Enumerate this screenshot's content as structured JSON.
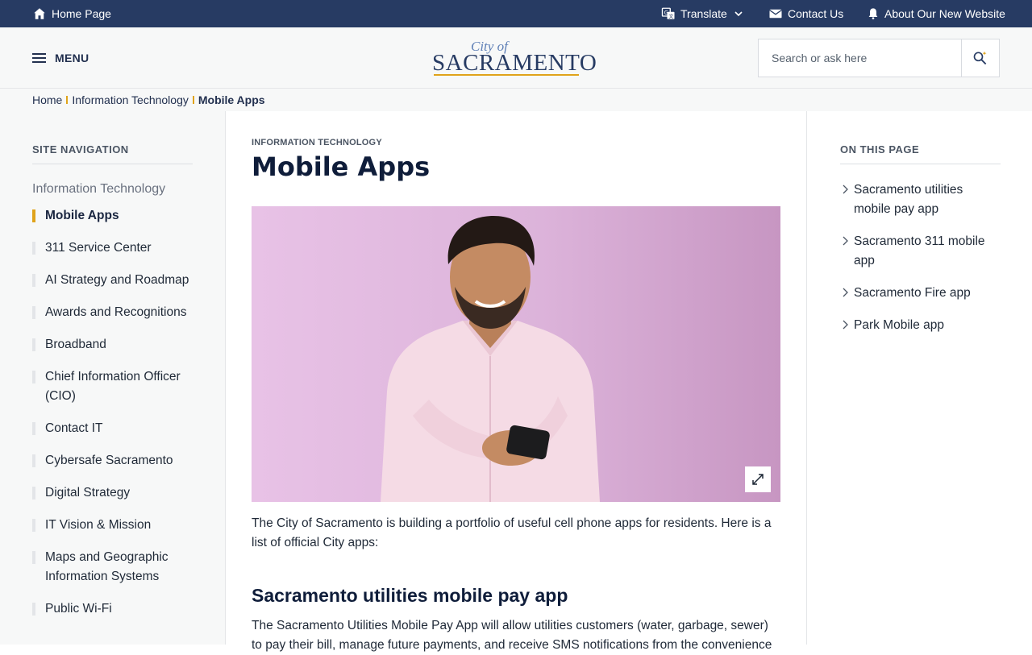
{
  "topbar": {
    "home": "Home Page",
    "translate": "Translate",
    "contact": "Contact Us",
    "about": "About Our New Website"
  },
  "header": {
    "menu": "MENU",
    "logo_cityof": "City of",
    "logo_name": "SACRAMENTO",
    "search_placeholder": "Search or ask here"
  },
  "breadcrumb": [
    "Home",
    "Information Technology",
    "Mobile Apps"
  ],
  "sidebar": {
    "heading": "SITE NAVIGATION",
    "parent": "Information Technology",
    "items": [
      {
        "label": "Mobile Apps"
      },
      {
        "label": "311 Service Center"
      },
      {
        "label": "AI Strategy and Roadmap"
      },
      {
        "label": "Awards and Recognitions"
      },
      {
        "label": "Broadband"
      },
      {
        "label": "Chief Information Officer (CIO)"
      },
      {
        "label": "Contact IT"
      },
      {
        "label": "Cybersafe Sacramento"
      },
      {
        "label": "Digital Strategy"
      },
      {
        "label": "IT Vision & Mission"
      },
      {
        "label": "Maps and Geographic Information Systems"
      },
      {
        "label": "Public Wi-Fi"
      }
    ]
  },
  "main": {
    "eyebrow": "INFORMATION TECHNOLOGY",
    "title": "Mobile Apps",
    "intro": "The City of Sacramento is building a portfolio of useful cell phone apps for residents. Here is a list of official City apps:",
    "section1_title": "Sacramento utilities mobile pay app",
    "section1_text": "The Sacramento Utilities Mobile Pay App will allow utilities customers (water, garbage, sewer) to pay their bill, manage future payments, and receive SMS notifications from the convenience"
  },
  "on_this_page": {
    "heading": "ON THIS PAGE",
    "items": [
      {
        "label": "Sacramento utilities mobile pay app"
      },
      {
        "label": "Sacramento 311 mobile app"
      },
      {
        "label": "Sacramento Fire app"
      },
      {
        "label": "Park Mobile app"
      }
    ]
  },
  "colors": {
    "topbar_bg": "#273b63",
    "accent": "#e0a31b",
    "heading": "#0f1d3a"
  }
}
